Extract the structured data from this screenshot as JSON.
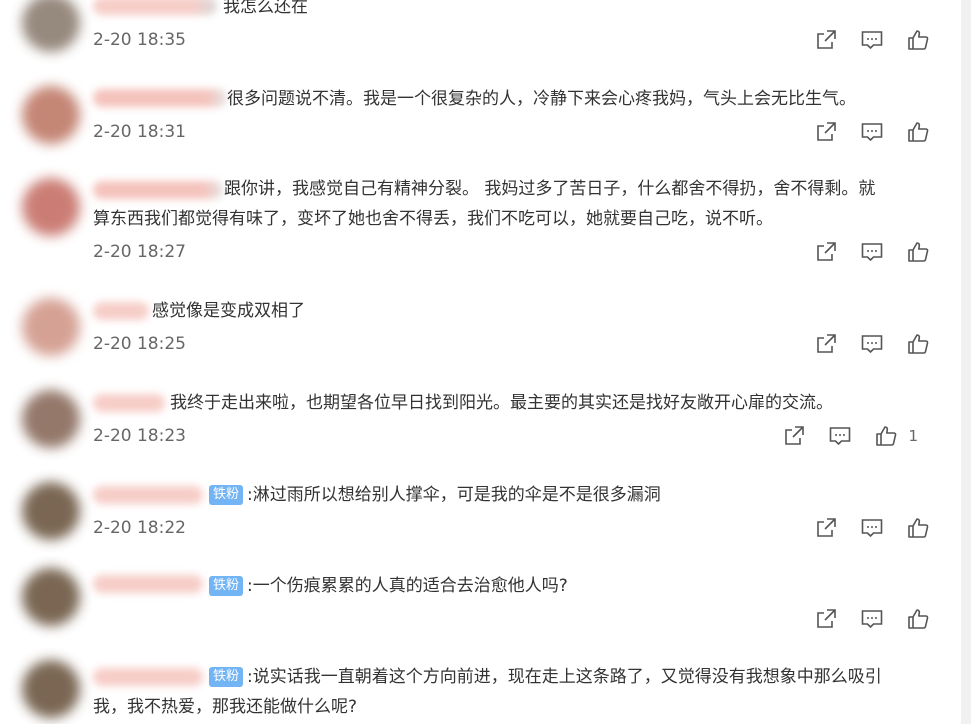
{
  "comments": [
    {
      "text": "我怎么还在",
      "text2": "",
      "time": "2-20 18:35",
      "badge": "",
      "likes": "",
      "avatar_color": "#8e7f73"
    },
    {
      "text": "很多问题说不清。我是一个很复杂的人，冷静下来会心疼我妈，气头上会无比生气。",
      "text2": "",
      "time": "2-20 18:31",
      "badge": "",
      "likes": "",
      "avatar_color": "#c07c6a"
    },
    {
      "text": "跟你讲，我感觉自己有精神分裂。 我妈过多了苦日子，什么都舍不得扔，舍不得剩。就",
      "text2": "算东西我们都觉得有味了，变坏了她也舍不得丢，我们不吃可以，她就要自己吃，说不听。",
      "time": "2-20 18:27",
      "badge": "",
      "likes": "",
      "avatar_color": "#c7736a"
    },
    {
      "text": "感觉像是变成双相了",
      "text2": "",
      "time": "2-20 18:25",
      "badge": "",
      "likes": "",
      "avatar_color": "#d29a8c"
    },
    {
      "text": "我终于走出来啦，也期望各位早日找到阳光。最主要的其实还是找好友敞开心扉的交流。",
      "text2": "",
      "time": "2-20 18:23",
      "badge": "",
      "likes": "1",
      "avatar_color": "#8b6d5e"
    },
    {
      "text": ":淋过雨所以想给别人撑伞，可是我的伞是不是很多漏洞",
      "text2": "",
      "time": "2-20 18:22",
      "badge": "铁粉",
      "likes": "",
      "avatar_color": "#6f5a45"
    },
    {
      "text": ":一个伤痕累累的人真的适合去治愈他人吗?",
      "text2": "",
      "time": "",
      "badge": "铁粉",
      "likes": "",
      "avatar_color": "#6f5a45"
    },
    {
      "text": ":说实话我一直朝着这个方向前进，现在走上这条路了，又觉得没有我想象中那么吸引",
      "text2": "我，我不热爱，那我还能做什么呢?",
      "time": "",
      "badge": "铁粉",
      "likes": "",
      "avatar_color": "#6f5a45"
    }
  ],
  "icons": {
    "share": "share-icon",
    "reply": "comment-icon",
    "like": "thumbs-up-icon"
  },
  "colors": {
    "badge": "#73b4f4",
    "name_blur": "#f3b8b0",
    "icon": "#555555"
  }
}
